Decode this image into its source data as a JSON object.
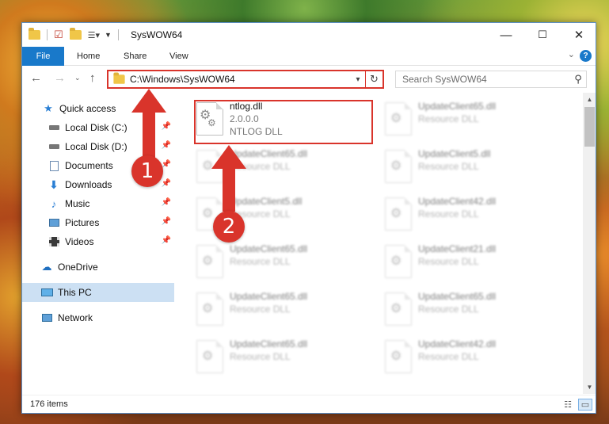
{
  "window": {
    "title": "SysWOW64",
    "minimize": "—",
    "maximize": "☐",
    "close": "✕"
  },
  "ribbon": {
    "tabs": [
      "File",
      "Home",
      "Share",
      "View"
    ],
    "help": "?"
  },
  "address": {
    "path": "C:\\Windows\\SysWOW64"
  },
  "search": {
    "placeholder": "Search SysWOW64"
  },
  "sidebar": {
    "items": [
      {
        "label": "Quick access",
        "icon": "star-icon"
      },
      {
        "label": "Local Disk (C:)",
        "icon": "drive-icon",
        "pinned": true
      },
      {
        "label": "Local Disk (D:)",
        "icon": "drive-icon",
        "pinned": true
      },
      {
        "label": "Documents",
        "icon": "documents-icon",
        "pinned": true
      },
      {
        "label": "Downloads",
        "icon": "download-icon",
        "pinned": true
      },
      {
        "label": "Music",
        "icon": "music-icon",
        "pinned": true
      },
      {
        "label": "Pictures",
        "icon": "pictures-icon",
        "pinned": true
      },
      {
        "label": "Videos",
        "icon": "videos-icon",
        "pinned": true
      },
      {
        "label": "OneDrive",
        "icon": "cloud-icon"
      },
      {
        "label": "This PC",
        "icon": "computer-icon",
        "selected": true
      },
      {
        "label": "Network",
        "icon": "network-icon"
      }
    ]
  },
  "files": [
    {
      "name": "ntlog.dll",
      "version": "2.0.0.0",
      "description": "NTLOG DLL"
    },
    {
      "name": "UpdateClient65.dll",
      "description": "Resource DLL"
    },
    {
      "name": "UpdateClient65.dll",
      "description": "Resource DLL"
    },
    {
      "name": "UpdateClient5.dll",
      "description": "Resource DLL"
    },
    {
      "name": "UpdateClient5.dll",
      "description": "Resource DLL"
    },
    {
      "name": "UpdateClient42.dll",
      "description": "Resource DLL"
    },
    {
      "name": "UpdateClient65.dll",
      "description": "Resource DLL"
    },
    {
      "name": "UpdateClient21.dll",
      "description": "Resource DLL"
    },
    {
      "name": "UpdateClient65.dll",
      "description": "Resource DLL"
    },
    {
      "name": "UpdateClient65.dll",
      "description": "Resource DLL"
    },
    {
      "name": "UpdateClient65.dll",
      "description": "Resource DLL"
    },
    {
      "name": "UpdateClient42.dll",
      "description": "Resource DLL"
    }
  ],
  "status": {
    "item_count": "176 items"
  },
  "annotations": {
    "step1": "1",
    "step2": "2",
    "color": "#d9342b"
  }
}
